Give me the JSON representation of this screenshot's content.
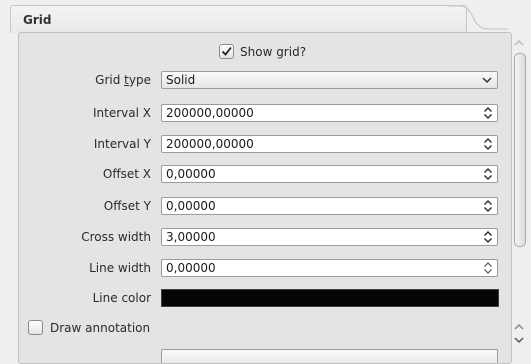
{
  "group": {
    "title": "Grid"
  },
  "show_grid": {
    "label": "Show grid?",
    "checked": true
  },
  "grid_type": {
    "label": "Grid type",
    "value": "Solid"
  },
  "interval_x": {
    "label": "Interval X",
    "value": "200000,00000"
  },
  "interval_y": {
    "label": "Interval Y",
    "value": "200000,00000"
  },
  "offset_x": {
    "label": "Offset X",
    "value": "0,00000"
  },
  "offset_y": {
    "label": "Offset Y",
    "value": "0,00000"
  },
  "cross_width": {
    "label": "Cross width",
    "value": "3,00000"
  },
  "line_width": {
    "label": "Line width",
    "value": "0,00000"
  },
  "line_color": {
    "label": "Line color",
    "color": "#050505"
  },
  "draw_annotation": {
    "label": "Draw annotation",
    "checked": false
  }
}
